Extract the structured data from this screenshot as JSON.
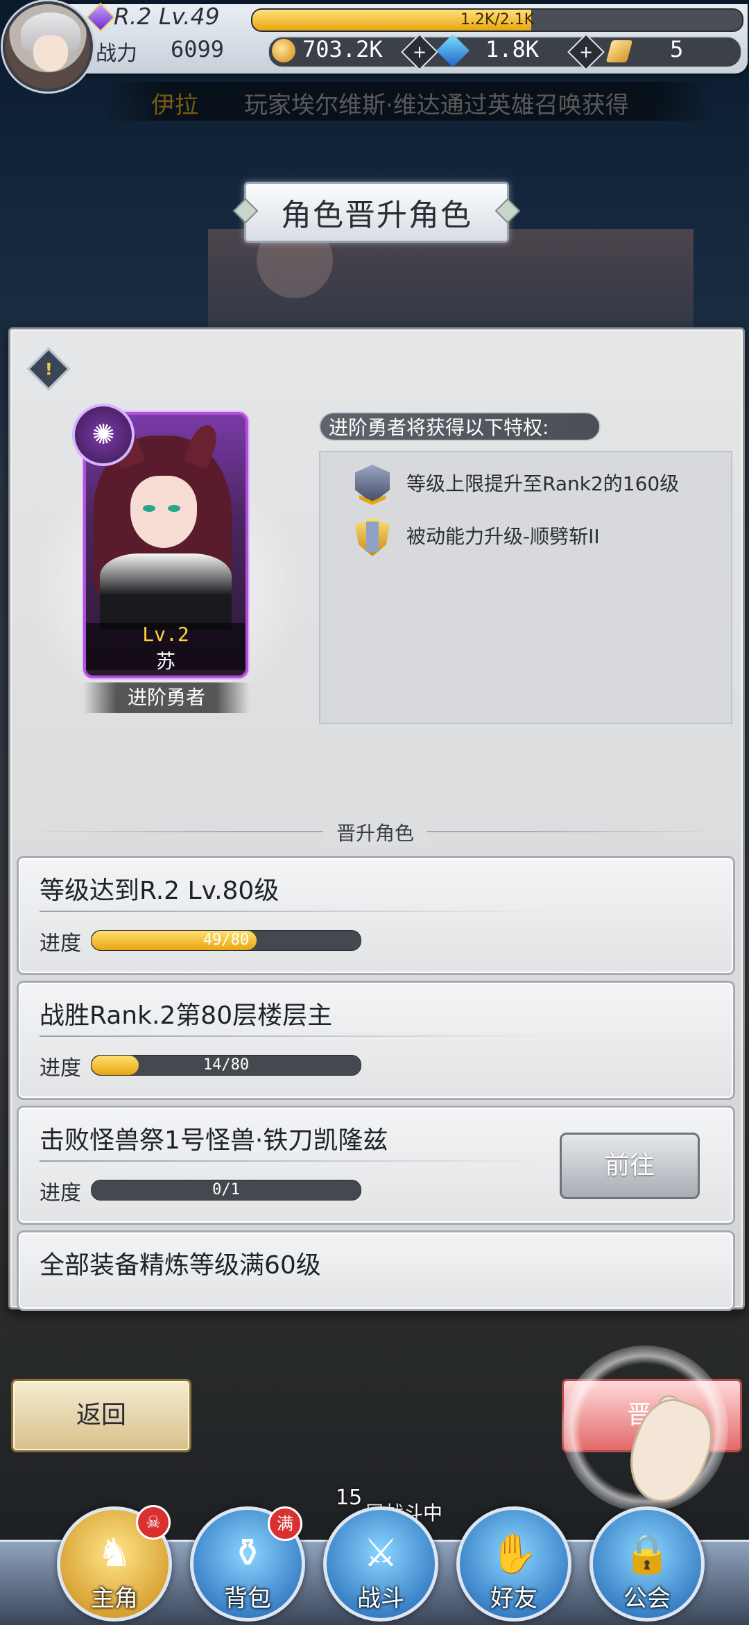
{
  "top_bar": {
    "rank_level": "R.2 Lv.49",
    "exp_text": "1.2K/2.1K",
    "exp_progress": 0.57,
    "power_label": "战力",
    "power_value": "6099",
    "gold": "703.2K",
    "gems": "1.8K",
    "tickets": "5",
    "plus_glyph": "+"
  },
  "marquee": {
    "name": "伊拉",
    "text": "玩家埃尔维斯·维达通过英雄召唤获得"
  },
  "title": "角色晋升角色",
  "panel": {
    "warning_glyph": "!",
    "hero": {
      "class_glyph": "✺",
      "level": "Lv.2",
      "name": "苏",
      "tag": "进阶勇者"
    },
    "privileges": {
      "title": "进阶勇者将获得以下特权:",
      "items": [
        {
          "icon": "fist-rank-icon",
          "text": "等级上限提升至Rank2的160级"
        },
        {
          "icon": "sword-shield-icon",
          "text": "被动能力升级-顺劈斩II"
        }
      ]
    },
    "section_label": "晋升角色",
    "requirements": [
      {
        "title": "等级达到R.2 Lv.80级",
        "progress_label": "进度",
        "progress_text": "49/80",
        "progress": 0.6125
      },
      {
        "title": "战胜Rank.2第80层楼层主",
        "progress_label": "进度",
        "progress_text": "14/80",
        "progress": 0.175
      },
      {
        "title": "击败怪兽祭1号怪兽·铁刀凯隆兹",
        "progress_label": "进度",
        "progress_text": "0/1",
        "progress": 0,
        "button": "前往"
      },
      {
        "title": "全部装备精炼等级满60级"
      }
    ]
  },
  "buttons": {
    "back": "返回",
    "promote": "晋升"
  },
  "nav": {
    "floor_number": "15",
    "floor_status": "层战斗中",
    "items": [
      {
        "label": "主角",
        "icon": "hero-helmet-icon",
        "glyph": "♞",
        "badge": "☠"
      },
      {
        "label": "背包",
        "icon": "backpack-icon",
        "glyph": "⚱",
        "badge": "满"
      },
      {
        "label": "战斗",
        "icon": "crossed-swords-icon",
        "glyph": "⚔"
      },
      {
        "label": "好友",
        "icon": "handshake-icon",
        "glyph": "✋"
      },
      {
        "label": "公会",
        "icon": "guild-lock-icon",
        "glyph": "🔒"
      }
    ]
  }
}
